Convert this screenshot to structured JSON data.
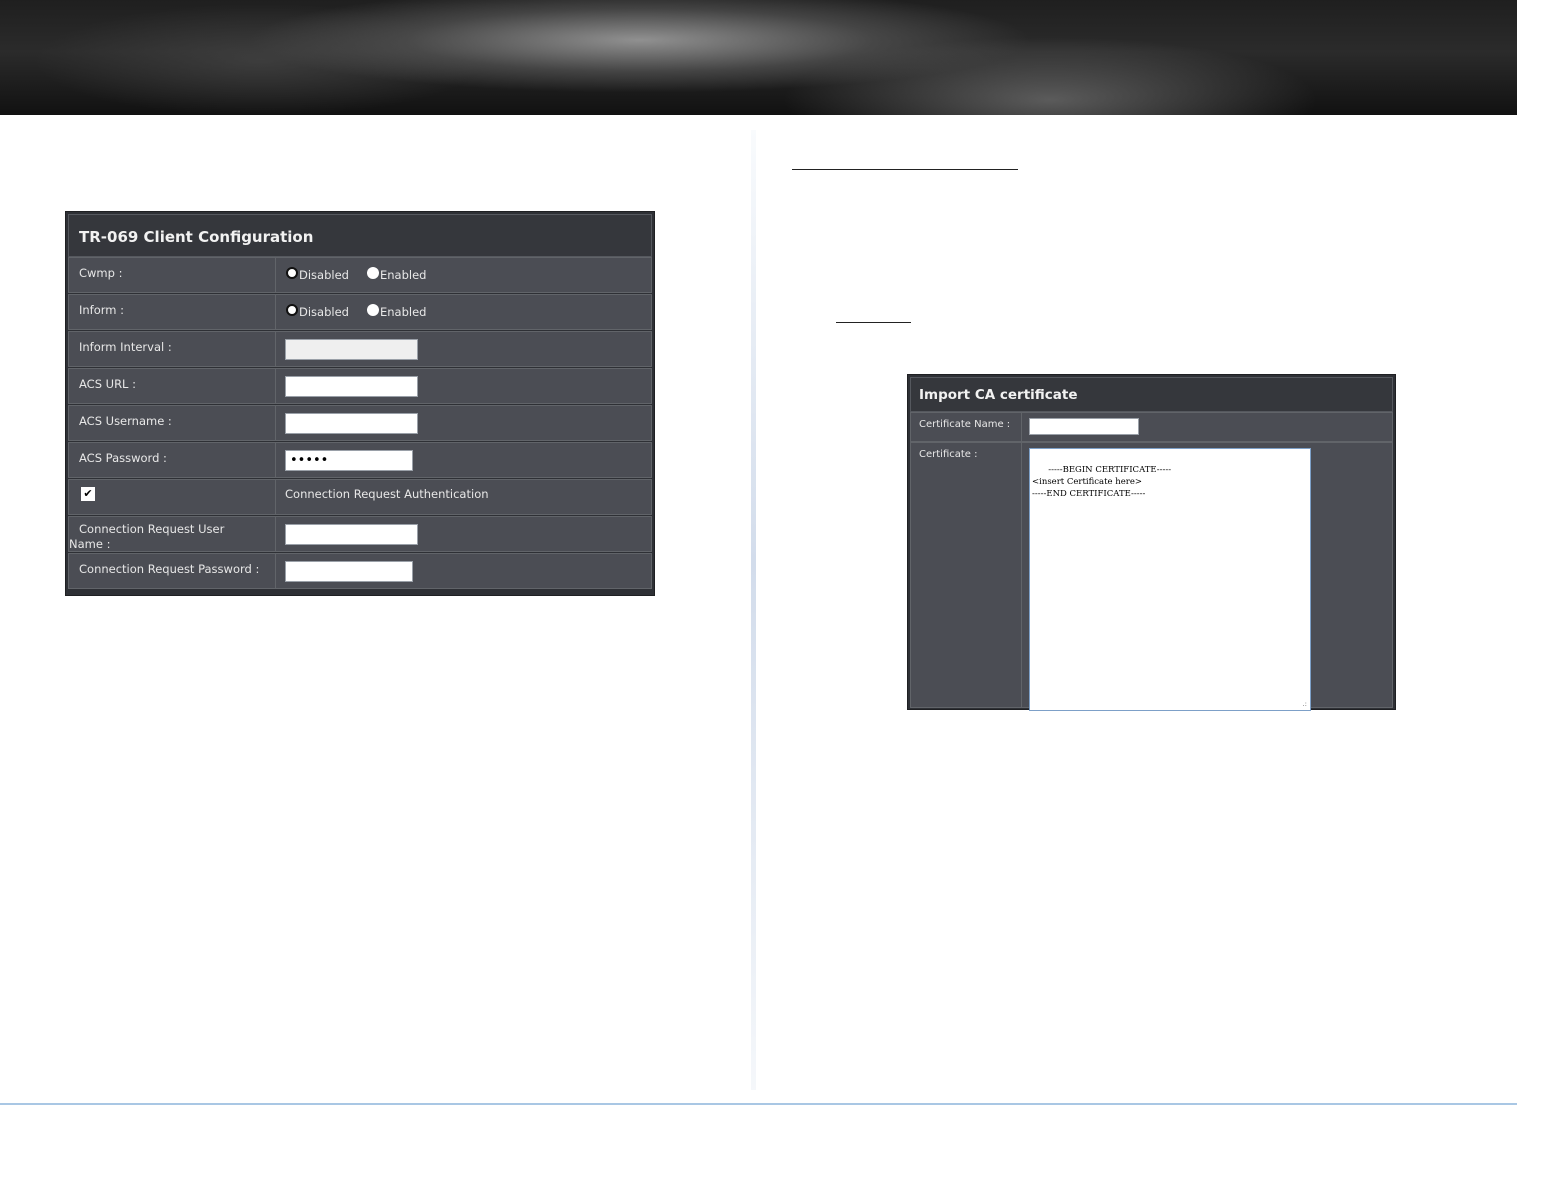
{
  "tr069": {
    "title": "TR-069 Client Configuration",
    "cwmp": {
      "label": "Cwmp :",
      "opt_disabled": "Disabled",
      "opt_enabled": "Enabled",
      "selected": "Disabled"
    },
    "inform": {
      "label": "Inform :",
      "opt_disabled": "Disabled",
      "opt_enabled": "Enabled",
      "selected": "Disabled"
    },
    "inform_interval": {
      "label": "Inform Interval :",
      "value": ""
    },
    "acs_url": {
      "label": "ACS URL :",
      "value": ""
    },
    "acs_username": {
      "label": "ACS Username :",
      "value": ""
    },
    "acs_password": {
      "label": "ACS Password :",
      "value": "•••••"
    },
    "conn_auth": {
      "label": "Connection Request Authentication",
      "checked": true,
      "check_glyph": "✔"
    },
    "conn_user": {
      "label_line1": "Connection Request User",
      "label_line2": "Name :",
      "value": ""
    },
    "conn_password": {
      "label": "Connection Request Password :",
      "value": ""
    }
  },
  "import_ca": {
    "title": "Import CA certificate",
    "name_label": "Certificate Name :",
    "name_value": "",
    "cert_label": "Certificate :",
    "cert_value": "-----BEGIN CERTIFICATE-----\n<insert Certificate here>\n-----END CERTIFICATE-----",
    "resize_glyph": ".:"
  }
}
